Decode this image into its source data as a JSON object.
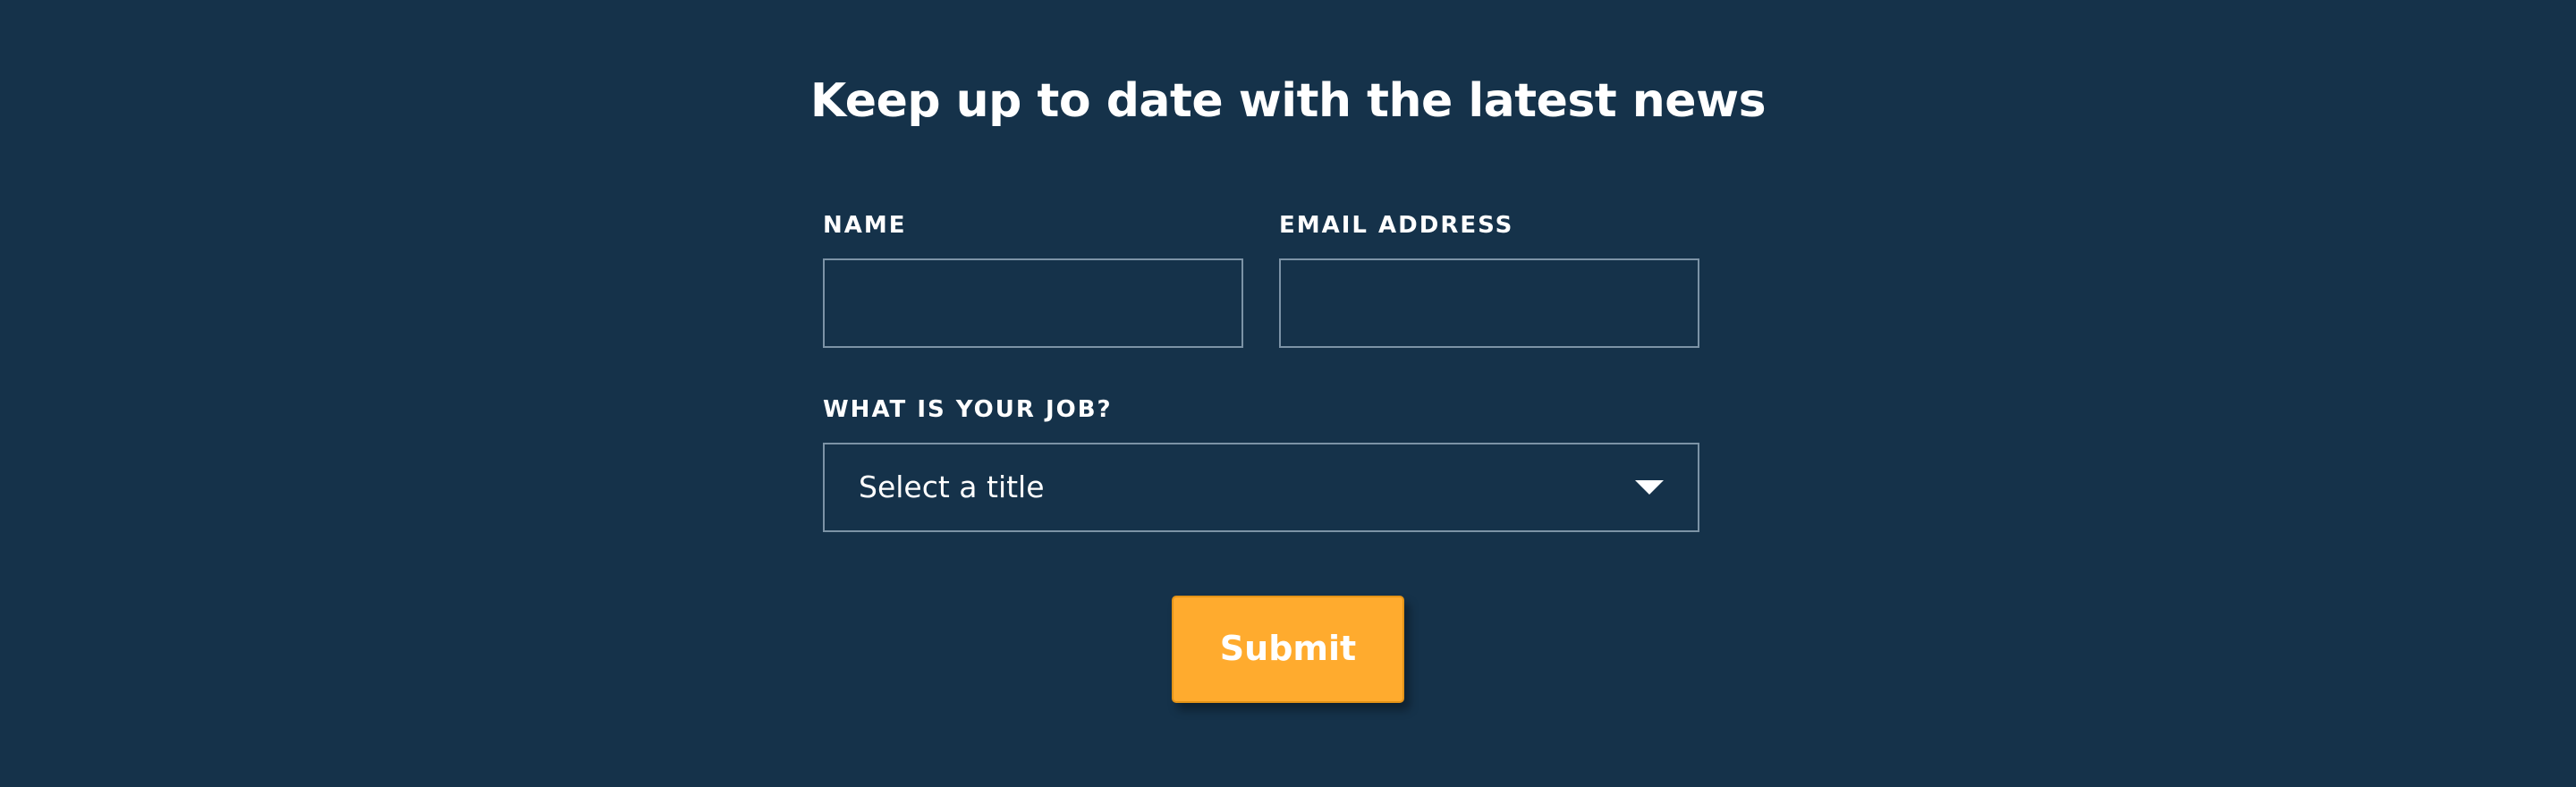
{
  "form": {
    "title": "Keep up to date with the latest news",
    "name_label": "NAME",
    "name_value": "",
    "email_label": "EMAIL ADDRESS",
    "email_value": "",
    "job_label": "WHAT IS YOUR JOB?",
    "job_selected": "Select a title",
    "submit_label": "Submit"
  },
  "colors": {
    "background": "#15324a",
    "field_border": "#7c93a6",
    "submit_button": "#ffab2e",
    "text": "#ffffff"
  },
  "icons": {
    "select_caret": "chevron-down-icon"
  }
}
